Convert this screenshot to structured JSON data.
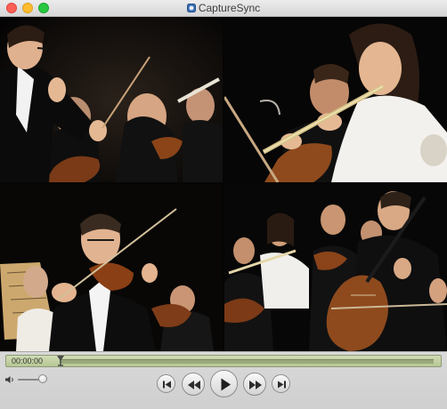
{
  "window": {
    "title": "CaptureSync"
  },
  "controller": {
    "time": "00:00:00"
  },
  "colors": {
    "close": "#fc5f57",
    "minimize": "#fdbd2e",
    "maximize": "#28c840",
    "timebar": "#c4d2a4"
  },
  "icons": {
    "app": "capturesync-app-icon",
    "playhead": "playhead-icon",
    "volume": "speaker-icon",
    "start": "skip-to-start-icon",
    "rewind": "rewind-icon",
    "play": "play-icon",
    "forward": "fast-forward-icon",
    "end": "skip-to-end-icon"
  }
}
